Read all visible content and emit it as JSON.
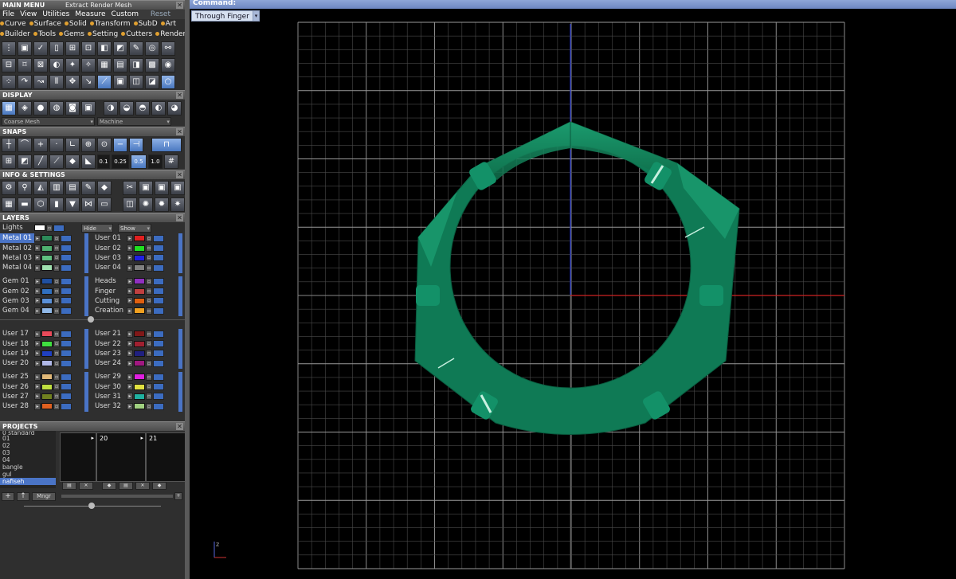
{
  "main_menu": {
    "title": "MAIN MENU",
    "subtitle": "Extract Render Mesh",
    "reset": "Reset"
  },
  "menubar": [
    "File",
    "View",
    "Utilities",
    "Measure",
    "Custom"
  ],
  "categories_row1": [
    "Curve",
    "Surface",
    "Solid",
    "Transform",
    "SubD",
    "Art"
  ],
  "categories_row2": [
    "Builder",
    "Tools",
    "Gems",
    "Setting",
    "Cutters",
    "Render"
  ],
  "panels": {
    "display": "DISPLAY",
    "snaps": "SNAPS",
    "info": "INFO & SETTINGS",
    "layers": "LAYERS",
    "projects": "PROJECTS"
  },
  "display": {
    "mesh_select": "Coarse Mesh",
    "material_select": "Machine"
  },
  "snaps": {
    "values": [
      "0.1",
      "0.25",
      "0.5",
      "1.0"
    ]
  },
  "layers": {
    "lights": "Lights",
    "hide": "Hide",
    "show": "Show",
    "left_groups": [
      [
        {
          "name": "Metal 01",
          "color": "#2d8a5a"
        },
        {
          "name": "Metal 02",
          "color": "#4fb070"
        },
        {
          "name": "Metal 03",
          "color": "#60c080"
        },
        {
          "name": "Metal 04",
          "color": "#a0e0b0"
        }
      ],
      [
        {
          "name": "Gem 01",
          "color": "#2050a0"
        },
        {
          "name": "Gem 02",
          "color": "#3070c0"
        },
        {
          "name": "Gem 03",
          "color": "#5a90d8"
        },
        {
          "name": "Gem 04",
          "color": "#90b8e8"
        }
      ],
      [
        {
          "name": "User 17",
          "color": "#e84a5a"
        },
        {
          "name": "User 18",
          "color": "#40e040"
        },
        {
          "name": "User 19",
          "color": "#2040c0"
        },
        {
          "name": "User 20",
          "color": "#b0b8e8"
        }
      ],
      [
        {
          "name": "User 25",
          "color": "#e0b878"
        },
        {
          "name": "User 26",
          "color": "#c0e040"
        },
        {
          "name": "User 27",
          "color": "#708020"
        },
        {
          "name": "User 28",
          "color": "#e06020"
        }
      ]
    ],
    "right_groups": [
      [
        {
          "name": "User 01",
          "color": "#e02020"
        },
        {
          "name": "User 02",
          "color": "#20e020"
        },
        {
          "name": "User 03",
          "color": "#2020e0"
        },
        {
          "name": "User 04",
          "color": "#808080"
        }
      ],
      [
        {
          "name": "Heads",
          "color": "#9030c0"
        },
        {
          "name": "Finger",
          "color": "#c04040"
        },
        {
          "name": "Cutting",
          "color": "#e06010"
        },
        {
          "name": "Creation",
          "color": "#f0a020"
        }
      ],
      [
        {
          "name": "User 21",
          "color": "#801818"
        },
        {
          "name": "User 22",
          "color": "#a02030"
        },
        {
          "name": "User 23",
          "color": "#202080"
        },
        {
          "name": "User 24",
          "color": "#a01880"
        }
      ],
      [
        {
          "name": "User 29",
          "color": "#e020e0"
        },
        {
          "name": "User 30",
          "color": "#e0e040"
        },
        {
          "name": "User 31",
          "color": "#20b0a0"
        },
        {
          "name": "User 32",
          "color": "#a0d080"
        }
      ]
    ]
  },
  "projects": {
    "list": [
      "0 standard",
      "01",
      "02",
      "03",
      "04",
      "bangle",
      "gul",
      "nafiseh"
    ],
    "selected": "nafiseh",
    "thumbs": [
      "",
      "20",
      "21"
    ],
    "mngr": "Mngr"
  },
  "viewport": {
    "command": "Command:",
    "view_name": "Through Finger",
    "ring_color": "#138a5e",
    "grid_color": "#5a5a5a"
  }
}
